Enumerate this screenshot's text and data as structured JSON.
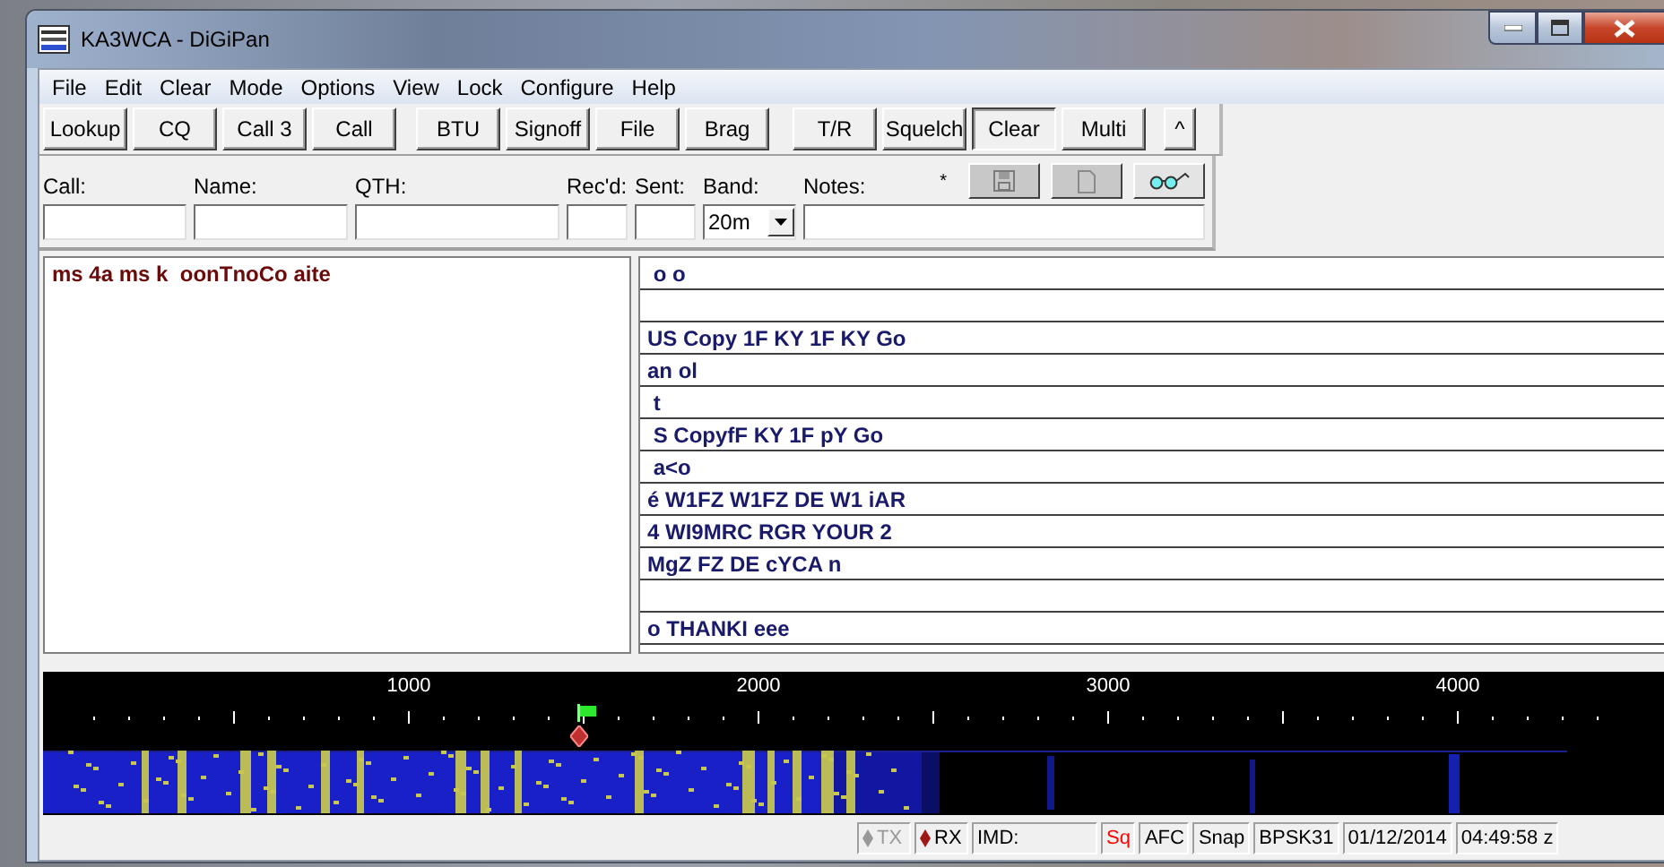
{
  "window": {
    "title": "KA3WCA - DiGiPan"
  },
  "menu": [
    "File",
    "Edit",
    "Clear",
    "Mode",
    "Options",
    "View",
    "Lock",
    "Configure",
    "Help"
  ],
  "toolbar": [
    {
      "label": "Lookup",
      "kind": "text",
      "pressed": false
    },
    {
      "label": "CQ",
      "kind": "text",
      "pressed": false
    },
    {
      "label": "Call 3",
      "kind": "text",
      "pressed": false
    },
    {
      "label": "Call",
      "kind": "text",
      "pressed": false
    },
    {
      "label": "BTU",
      "kind": "text",
      "pressed": false
    },
    {
      "label": "Signoff",
      "kind": "text",
      "pressed": false
    },
    {
      "label": "File",
      "kind": "text",
      "pressed": false
    },
    {
      "label": "Brag",
      "kind": "text",
      "pressed": false
    },
    {
      "label": "T/R",
      "kind": "text",
      "pressed": false
    },
    {
      "label": "Squelch",
      "kind": "text",
      "pressed": false
    },
    {
      "label": "Clear",
      "kind": "text",
      "pressed": true
    },
    {
      "label": "Multi",
      "kind": "text",
      "pressed": false
    },
    {
      "label": "^",
      "kind": "small",
      "pressed": false
    }
  ],
  "fields": [
    {
      "label": "Call:",
      "kind": "text"
    },
    {
      "label": "Name:",
      "kind": "text"
    },
    {
      "label": "QTH:",
      "kind": "text"
    },
    {
      "label": "Rec'd:",
      "kind": "text"
    },
    {
      "label": "Sent:",
      "kind": "text"
    },
    {
      "label": "Band:",
      "kind": "dropdown",
      "value": "20m"
    },
    {
      "label": "Notes:",
      "kind": "text"
    }
  ],
  "notes_marker": "*",
  "notes_buttons": [
    {
      "kind": "save",
      "disabled": true
    },
    {
      "kind": "document",
      "disabled": true
    },
    {
      "kind": "glasses",
      "disabled": false
    }
  ],
  "tx_pane": {
    "text": "ms 4a ms k  oonTnoCo aite"
  },
  "rx_lines": [
    {
      "kind": "line",
      "text": " o o"
    },
    {
      "kind": "blank"
    },
    {
      "kind": "line",
      "text": "US Copy 1F KY 1F KY Go"
    },
    {
      "kind": "line",
      "text": "an ol"
    },
    {
      "kind": "line",
      "text": " t"
    },
    {
      "kind": "line",
      "text": " S CopyfF KY 1F pY Go"
    },
    {
      "kind": "line",
      "text": " a<o"
    },
    {
      "kind": "line",
      "text": "é W1FZ W1FZ DE W1 iAR"
    },
    {
      "kind": "line",
      "text": "4 WI9MRC RGR YOUR 2"
    },
    {
      "kind": "line",
      "text": "MgZ FZ DE cYCA n"
    },
    {
      "kind": "blank"
    },
    {
      "kind": "line",
      "text": "o THANKI eee"
    }
  ],
  "waterfall": {
    "scale": [
      "1000",
      "2000",
      "3000",
      "4000"
    ]
  },
  "status_bar": [
    {
      "kind": "tx",
      "text": "TX",
      "disabled": true
    },
    {
      "kind": "rx",
      "text": "RX",
      "disabled": false
    },
    {
      "kind": "imd",
      "text": "IMD:"
    },
    {
      "kind": "flag",
      "text": "Sq",
      "alert": true
    },
    {
      "kind": "flag",
      "text": "AFC",
      "alert": false
    },
    {
      "kind": "flag",
      "text": "Snap",
      "alert": false
    },
    {
      "kind": "flag",
      "text": "BPSK31",
      "alert": false
    },
    {
      "kind": "flag",
      "text": "01/12/2014",
      "alert": false
    },
    {
      "kind": "flag",
      "text": "04:49:58 z",
      "alert": false
    }
  ]
}
